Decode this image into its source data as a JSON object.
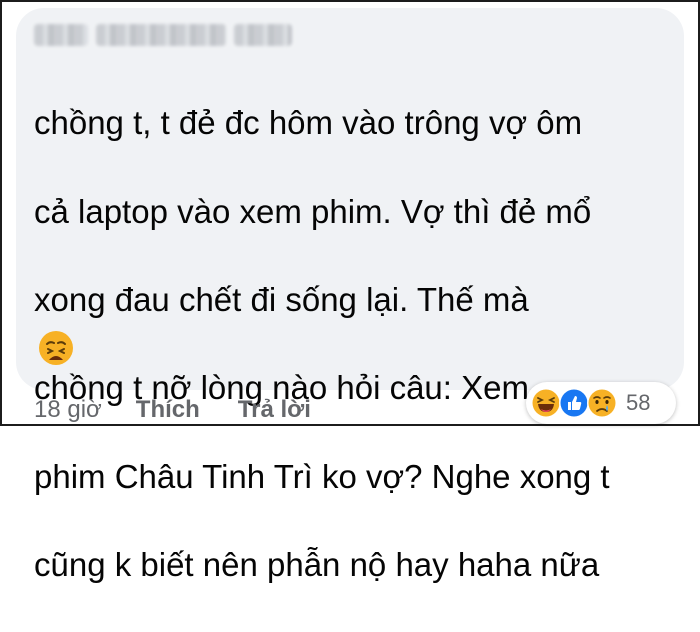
{
  "comment": {
    "text_lines": [
      "chồng t, t đẻ đc hôm vào trông vợ ôm",
      "cả laptop vào xem phim. Vợ thì đẻ mổ",
      "xong đau chết đi sống lại. Thế mà",
      "chồng t nỡ lòng nào hỏi câu: Xem",
      "phim Châu Tinh Trì ko vợ? Nghe xong t",
      "cũng k biết nên phẫn nộ hay haha nữa"
    ],
    "trailing_emoji": "weary-face-emoji"
  },
  "reactions": {
    "icons": [
      "haha-icon",
      "like-icon",
      "sad-icon"
    ],
    "count": "58"
  },
  "actions": {
    "time": "18 giờ",
    "like_label": "Thích",
    "reply_label": "Trả lời"
  },
  "colors": {
    "bubble": "#f0f2f5",
    "text": "#050505",
    "secondary": "#65676b",
    "like_blue": "#1877f2",
    "emoji_yellow": "#f7b125"
  }
}
